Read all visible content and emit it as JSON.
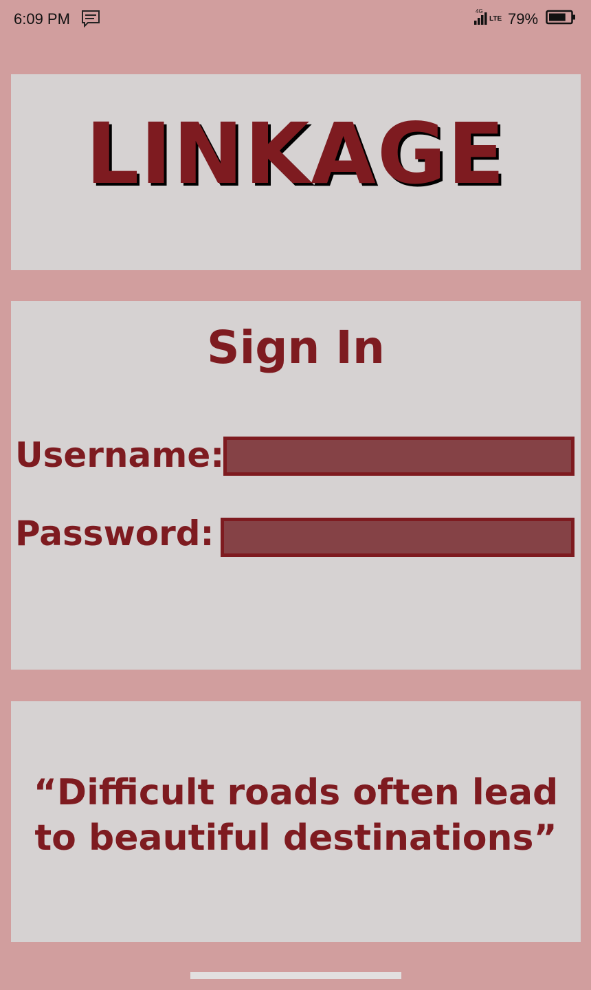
{
  "status_bar": {
    "time": "6:09 PM",
    "message_icon": "message-icon",
    "network_type": "4G",
    "network_label": "LTE",
    "battery_percent": "79%",
    "battery_level": 0.79
  },
  "logo": {
    "text": "LINKAGE"
  },
  "signin": {
    "title": "Sign In",
    "username_label": "Username:",
    "username_value": "",
    "password_label": "Password:",
    "password_value": ""
  },
  "quote": {
    "line1": "“Difficult roads often lead",
    "line2": "to beautiful destinations”"
  },
  "colors": {
    "background": "#d19e9e",
    "panel": "#d6d2d2",
    "accent": "#7e1b20",
    "input_fill": "#854246"
  }
}
